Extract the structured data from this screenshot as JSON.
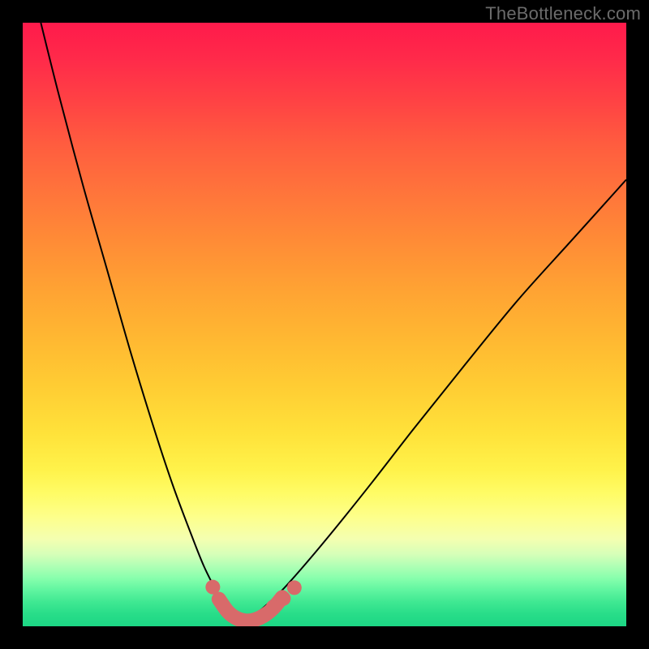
{
  "watermark": "TheBottleneck.com",
  "colors": {
    "curve": "#000000",
    "sweet_spot": "#d86a6a",
    "frame": "#000000"
  },
  "chart_data": {
    "type": "line",
    "title": "",
    "xlabel": "",
    "ylabel": "",
    "xlim": [
      0,
      100
    ],
    "ylim": [
      0,
      100
    ],
    "grid": false,
    "legend": false,
    "annotations": [
      "TheBottleneck.com"
    ],
    "series": [
      {
        "name": "left-curve",
        "x": [
          3,
          6,
          10,
          14,
          18,
          22,
          25,
          28,
          30,
          32,
          33.5,
          35,
          36.5
        ],
        "y": [
          100,
          88,
          73,
          59,
          45,
          32,
          23,
          15,
          10,
          6,
          3.5,
          1.8,
          0.8
        ]
      },
      {
        "name": "right-curve",
        "x": [
          36.5,
          38,
          40,
          43,
          47,
          52,
          58,
          65,
          73,
          82,
          91,
          100
        ],
        "y": [
          0.8,
          1.6,
          3.2,
          6,
          10.5,
          16.5,
          24,
          33,
          43,
          54,
          64,
          74
        ]
      },
      {
        "name": "sweet-spot-band",
        "x": [
          32.5,
          34,
          35.5,
          37,
          38.5,
          40,
          41.5,
          43
        ],
        "y": [
          4.5,
          2.4,
          1.3,
          0.9,
          1.1,
          1.8,
          3.0,
          4.8
        ]
      }
    ],
    "sweet_spot_markers": [
      {
        "x": 31.5,
        "y": 6.5
      },
      {
        "x": 41.5,
        "y": 3.2
      },
      {
        "x": 43.2,
        "y": 4.6
      },
      {
        "x": 45.0,
        "y": 6.4
      }
    ]
  }
}
